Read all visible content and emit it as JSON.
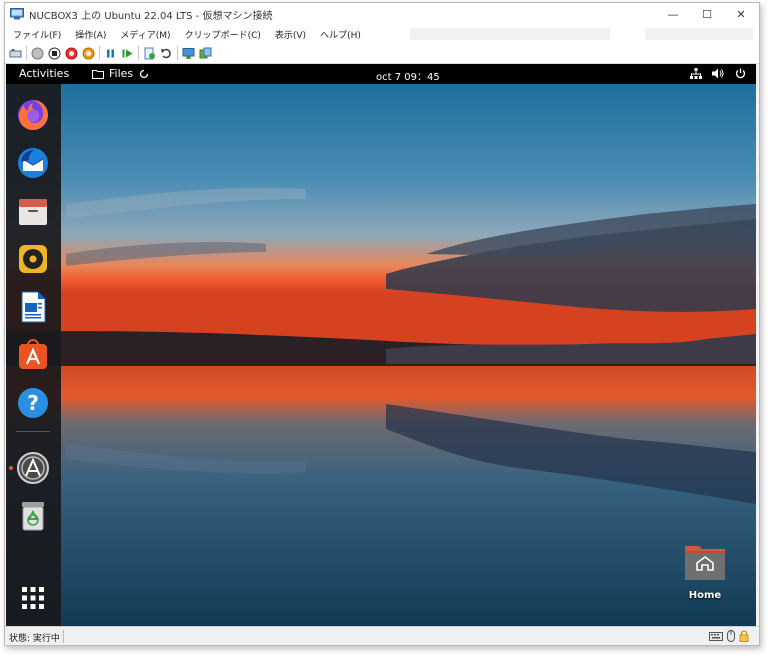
{
  "window": {
    "title": "NUCBOX3 上の Ubuntu 22.04 LTS - 仮想マシン接続",
    "controls": {
      "minimize": "—",
      "maximize": "☐",
      "close": "✕"
    }
  },
  "menubar": [
    "ファイル(F)",
    "操作(A)",
    "メディア(M)",
    "クリップボード(C)",
    "表示(V)",
    "ヘルプ(H)"
  ],
  "toolbar_icons": [
    "ctrl-alt-del-icon",
    "start-icon",
    "stop-icon",
    "shutdown-icon",
    "save-icon",
    "pause-icon",
    "resume-icon",
    "checkpoint-icon",
    "revert-icon",
    "enhanced-session-icon",
    "share-icon"
  ],
  "ubuntu": {
    "activities": "Activities",
    "app_menu": "Files",
    "clock": "oct 7  09：45",
    "tray": [
      "network-icon",
      "volume-icon",
      "power-icon"
    ],
    "dock": [
      "firefox-icon",
      "thunderbird-icon",
      "files-icon",
      "rhythmbox-icon",
      "libreoffice-writer-icon",
      "ubuntu-software-icon",
      "help-icon",
      "software-updater-icon",
      "trash-icon",
      "show-applications-icon"
    ],
    "desktop_home_label": "Home"
  },
  "statusbar": {
    "status": "状態: 実行中",
    "icons": [
      "keyboard-icon",
      "mouse-icon",
      "lock-icon"
    ]
  },
  "colors": {
    "ubuntu_orange": "#e95420",
    "dock_bg": "#19191c"
  }
}
